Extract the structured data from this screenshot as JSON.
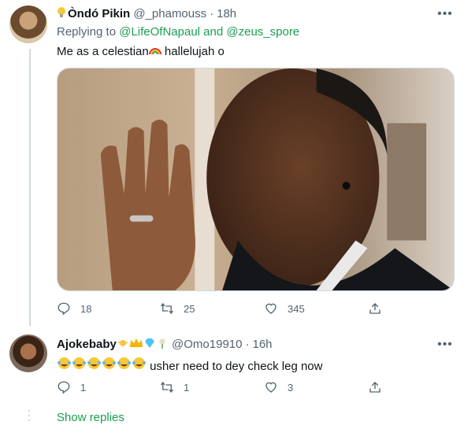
{
  "tweets": [
    {
      "display_name": "Òndó Pikin",
      "handle": "@_phamouss",
      "time": "18h",
      "name_emoji": "bulb-icon",
      "replying_to_prefix": "Replying to",
      "replying_to_1": "@LifeOfNapaul",
      "replying_to_and": "and",
      "replying_to_2": "@zeus_spore",
      "text": "Me as a celestian",
      "text_after": " hallelujah o",
      "text_emoji": "rainbow-icon",
      "replies": "18",
      "retweets": "25",
      "likes": "345"
    },
    {
      "display_name": "Ajokebaby",
      "name_emojis": [
        "baby-angel-icon",
        "crown-icon",
        "gem-icon",
        "daisy-icon"
      ],
      "handle": "@Omo19910",
      "time": "16h",
      "text_emojis": [
        "laughing-icon",
        "laughing-icon",
        "laughing-icon",
        "laughing-icon",
        "laughing-icon",
        "laughing-icon"
      ],
      "text": "usher need to dey check leg now",
      "replies": "1",
      "retweets": "1",
      "likes": "3"
    }
  ],
  "separator": "·",
  "show_replies": "Show replies",
  "colors": {
    "link": "#1d9bf0",
    "green_link": "#1b9e52",
    "secondary": "#536471"
  }
}
